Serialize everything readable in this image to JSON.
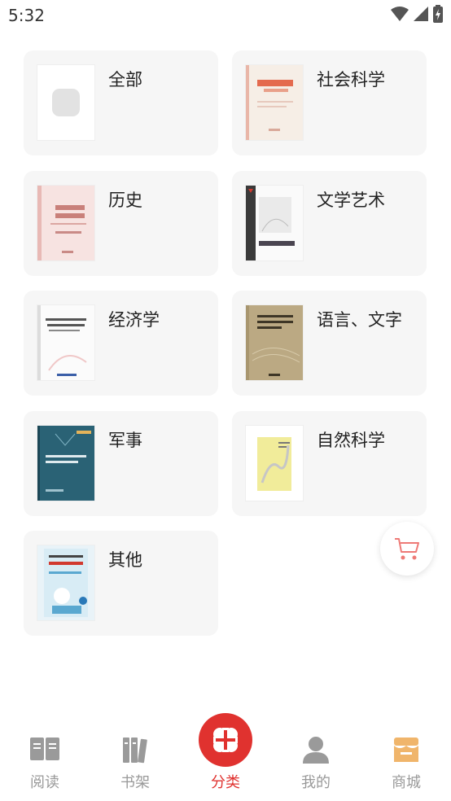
{
  "status_bar": {
    "time": "5:32"
  },
  "categories": [
    {
      "label": "全部"
    },
    {
      "label": "社会科学"
    },
    {
      "label": "历史"
    },
    {
      "label": "文学艺术"
    },
    {
      "label": "经济学"
    },
    {
      "label": "语言、文字"
    },
    {
      "label": "军事"
    },
    {
      "label": "自然科学"
    },
    {
      "label": "其他"
    }
  ],
  "tabbar": {
    "items": [
      {
        "label": "阅读",
        "icon": "book-open-icon"
      },
      {
        "label": "书架",
        "icon": "bookshelf-icon"
      },
      {
        "label": "分类",
        "icon": "category-icon",
        "active": true
      },
      {
        "label": "我的",
        "icon": "user-icon"
      },
      {
        "label": "商城",
        "icon": "store-icon"
      }
    ]
  },
  "colors": {
    "accent": "#e0322f",
    "card_bg": "#f6f6f6",
    "inactive": "#999999"
  }
}
